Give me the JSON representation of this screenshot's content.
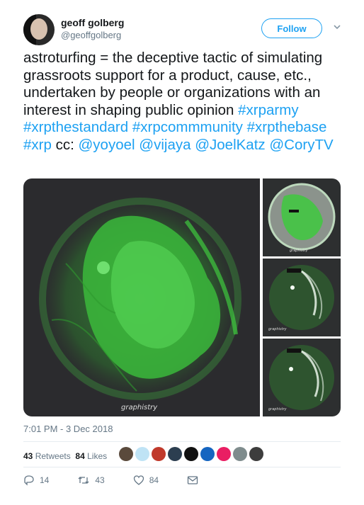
{
  "user": {
    "name": "geoff golberg",
    "handle": "@geoffgolberg"
  },
  "follow_label": "Follow",
  "tweet": {
    "text_plain": "astroturfing = the deceptive tactic of simulating grassroots support for a product, cause, etc., undertaken by people or organizations with an interest in shaping public opinion ",
    "hashtags": [
      "#xrparmy",
      "#xrpthestandard",
      "#xrpcommmunity",
      "#xrpthebase",
      "#xrp"
    ],
    "cc": "cc:",
    "mentions": [
      "@yoyoel",
      "@vijaya",
      "@JoelKatz",
      "@CoryTV"
    ]
  },
  "media": {
    "watermark": "graphistry"
  },
  "timestamp": "7:01 PM - 3 Dec 2018",
  "stats": {
    "retweets_count": "43",
    "retweets_label": "Retweets",
    "likes_count": "84",
    "likes_label": "Likes"
  },
  "likers": [
    {
      "icon": "avatar-photo",
      "color": "#5a4a3c"
    },
    {
      "icon": "snowflake-avatar",
      "color": "#bfe3f5"
    },
    {
      "icon": "avatar-photo",
      "color": "#c0392b"
    },
    {
      "icon": "avatar-photo",
      "color": "#2c3e50"
    },
    {
      "icon": "bird-avatar",
      "color": "#111111"
    },
    {
      "icon": "blue-logo-avatar",
      "color": "#1565c0"
    },
    {
      "icon": "pink-logo-avatar",
      "color": "#e91e63"
    },
    {
      "icon": "avatar-photo",
      "color": "#7f8c8d"
    },
    {
      "icon": "avatar-photo",
      "color": "#3d3d3d"
    }
  ],
  "actions": {
    "reply_count": "14",
    "retweet_count": "43",
    "like_count": "84"
  },
  "icons": {
    "reply": "reply-icon",
    "retweet": "retweet-icon",
    "like": "heart-icon",
    "message": "envelope-icon",
    "menu": "chevron-down-icon"
  },
  "colors": {
    "accent": "#1da1f2",
    "text": "#14171a",
    "muted": "#657786",
    "graph_green": "#3ec93e"
  }
}
